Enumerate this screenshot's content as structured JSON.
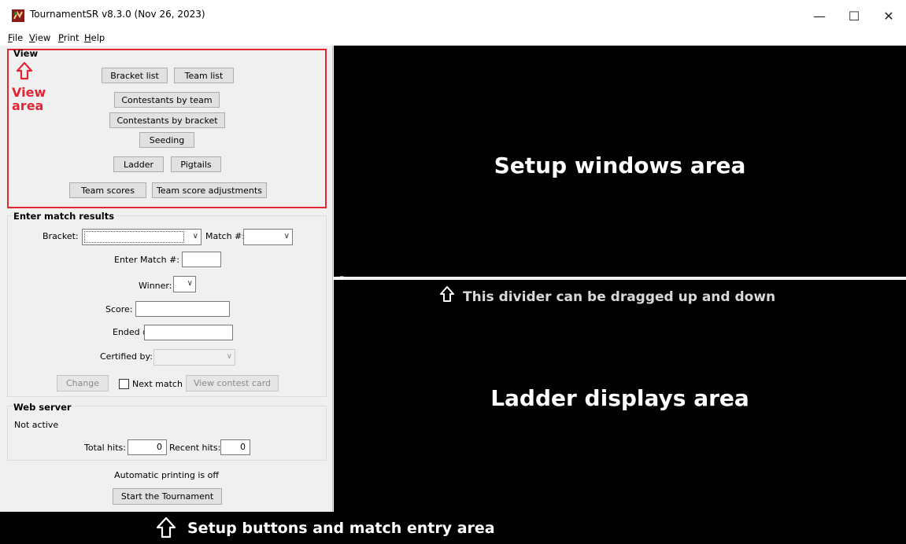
{
  "window": {
    "title": "TournamentSR v8.3.0 (Nov 26, 2023)",
    "controls": [
      "—",
      "☐",
      "✕"
    ]
  },
  "menu": {
    "items": [
      {
        "mnemonic": "F",
        "rest": "ile"
      },
      {
        "mnemonic": "V",
        "rest": "iew"
      },
      {
        "mnemonic": "P",
        "rest": "rint"
      },
      {
        "mnemonic": "H",
        "rest": "elp"
      }
    ]
  },
  "view_section": {
    "title": "View",
    "annotation_line1": "View",
    "annotation_line2": "area",
    "buttons": {
      "bracket_list": "Bracket list",
      "team_list": "Team list",
      "contestants_by_team": "Contestants by team",
      "contestants_by_bracket": "Contestants by bracket",
      "seeding": "Seeding",
      "ladder": "Ladder",
      "pigtails": "Pigtails",
      "team_scores": "Team scores",
      "team_score_adjustments": "Team score adjustments"
    }
  },
  "match_results": {
    "title": "Enter match results",
    "bracket_label": "Bracket:",
    "match_label": "Match #:",
    "enter_match_label": "Enter Match #:",
    "winner_label": "Winner:",
    "score_label": "Score:",
    "ended_label": "Ended @:",
    "certified_label": "Certified by:",
    "change_button": "Change",
    "next_match_label": "Next match",
    "view_contest_card_button": "View contest card"
  },
  "web_server": {
    "title": "Web server",
    "status": "Not active",
    "total_hits_label": "Total hits:",
    "total_hits_value": "0",
    "recent_hits_label": "Recent hits:",
    "recent_hits_value": "0"
  },
  "footer": {
    "auto_printing": "Automatic printing is off",
    "start_button": "Start the Tournament"
  },
  "annotations": {
    "setup_windows_area": "Setup windows area",
    "divider_note": "This divider can be dragged up and down",
    "ladder_displays_area": "Ladder displays area",
    "setup_buttons_area": "Setup buttons and match entry area"
  },
  "colors": {
    "annotation_red": "#e32636",
    "panel_bg": "#f0f0f0",
    "pane_bg": "#000000"
  },
  "icons": [
    "app-icon",
    "minimize-icon",
    "maximize-icon",
    "close-icon",
    "up-arrow-icon",
    "chevron-down-icon"
  ]
}
